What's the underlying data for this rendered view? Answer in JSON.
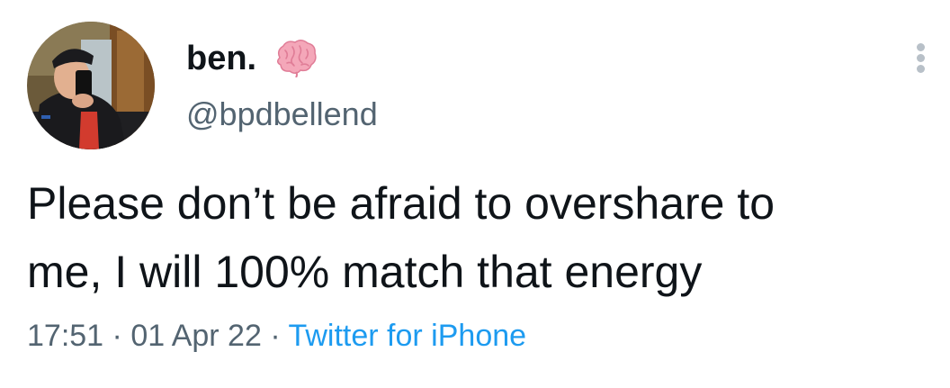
{
  "tweet": {
    "author": {
      "display_name": "ben.",
      "handle": "@bpdbellend",
      "name_emoji": "brain-icon"
    },
    "text_lines": [
      "Please don’t be afraid to overshare to",
      "me, I will 100% match that energy"
    ],
    "meta": {
      "time": "17:51",
      "separator": " · ",
      "date": "01 Apr 22",
      "source": "Twitter for iPhone"
    },
    "menu_icon": "more-vertical-icon"
  },
  "colors": {
    "text": "#0f1419",
    "secondary": "#536471",
    "link": "#1d9bf0",
    "brain": "#f4a7b9"
  }
}
